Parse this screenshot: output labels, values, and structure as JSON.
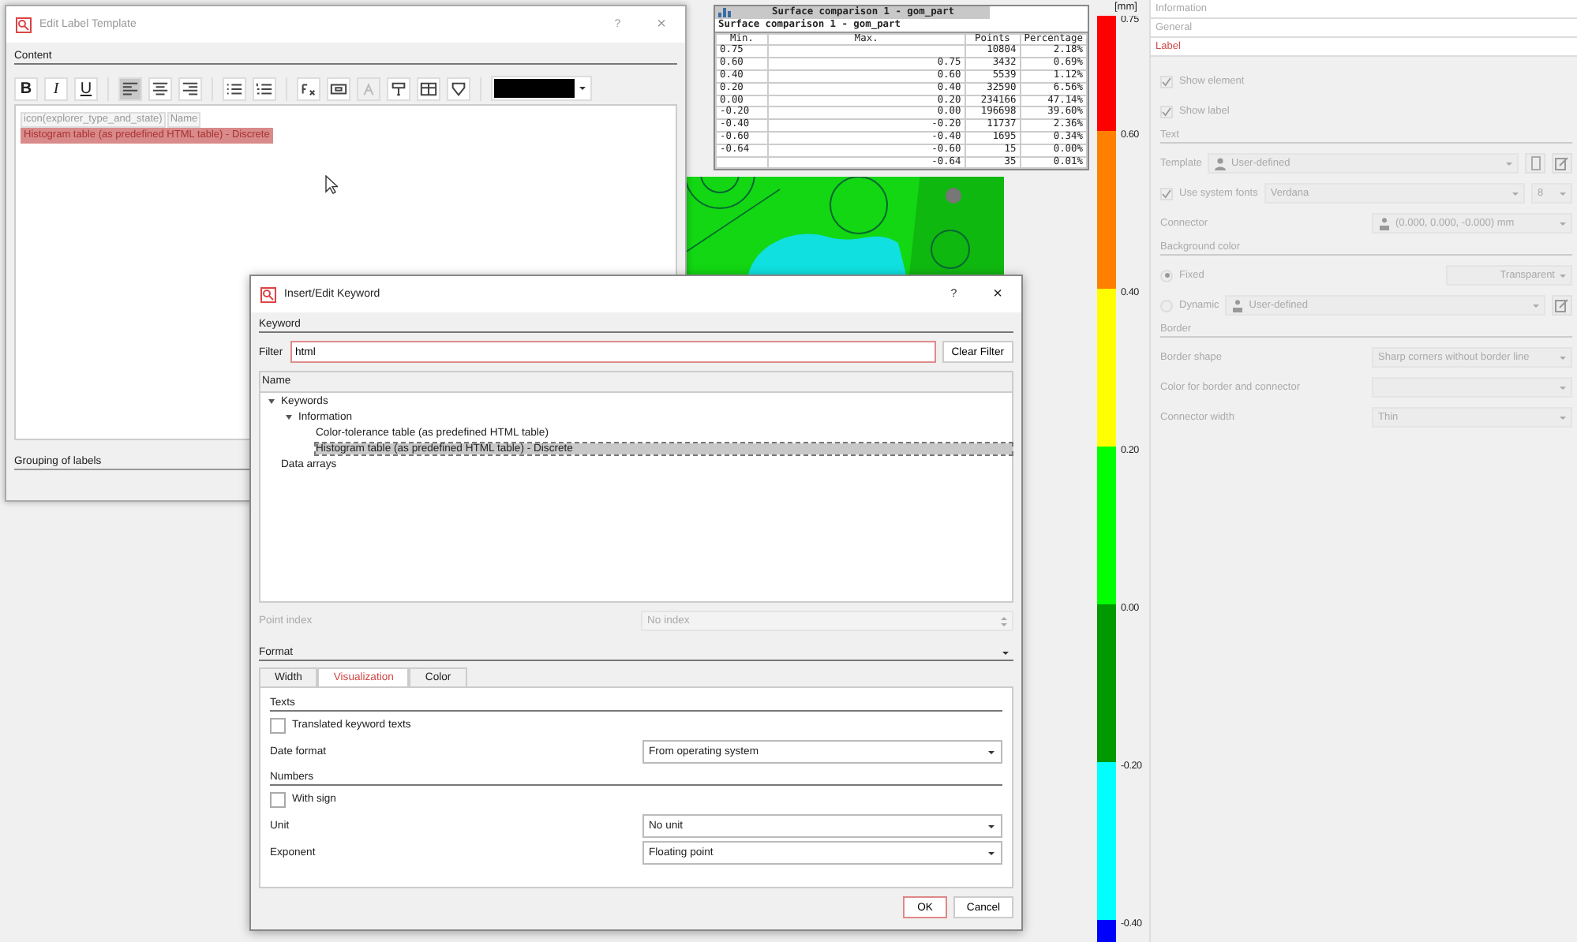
{
  "label_template_window": {
    "title": "Edit Label Template",
    "help": "?",
    "close": "×",
    "content_heading": "Content",
    "toolbar_groups": [
      {
        "tools": [
          {
            "kind": "bold",
            "label": "B",
            "pressed": false,
            "disabled": false
          },
          {
            "kind": "italic",
            "label": "I",
            "pressed": false,
            "disabled": false
          },
          {
            "kind": "underline",
            "label": "U",
            "pressed": false,
            "disabled": false
          }
        ]
      },
      {
        "tools": [
          {
            "kind": "align-left",
            "pressed": true,
            "disabled": false
          },
          {
            "kind": "align-center",
            "pressed": false,
            "disabled": false
          },
          {
            "kind": "align-right",
            "pressed": false,
            "disabled": false
          }
        ]
      },
      {
        "tools": [
          {
            "kind": "bullet-list",
            "pressed": false,
            "disabled": false
          },
          {
            "kind": "number-list",
            "pressed": false,
            "disabled": false
          }
        ]
      },
      {
        "tools": [
          {
            "kind": "formula",
            "pressed": false,
            "disabled": false
          },
          {
            "kind": "image",
            "pressed": false,
            "disabled": false
          },
          {
            "kind": "symbol",
            "pressed": false,
            "disabled": true
          },
          {
            "kind": "format-paint",
            "pressed": false,
            "disabled": false
          },
          {
            "kind": "table",
            "pressed": false,
            "disabled": false
          },
          {
            "kind": "insert-field",
            "pressed": false,
            "disabled": false
          }
        ]
      }
    ],
    "editor_lines": [
      {
        "tokens": [
          {
            "text": "icon(explorer_type_and_state)",
            "selected": false
          },
          {
            "text": "Name",
            "selected": false
          }
        ]
      },
      {
        "tokens": [
          {
            "text": "Histogram table (as predefined HTML table) - Discrete",
            "selected": true
          }
        ]
      }
    ],
    "grouping_heading": "Grouping of labels"
  },
  "histogram_table": {
    "title": "Surface comparison 1 - gom_part",
    "subtitle": "Surface comparison 1 - gom_part",
    "columns": [
      "Min.",
      "Max.",
      "Points",
      "Percentage"
    ],
    "rows": [
      {
        "min": "0.75",
        "points": "10804",
        "percentage": "2.18%"
      },
      {
        "min": "0.60",
        "max": "0.75",
        "points": "3432",
        "percentage": "0.69%"
      },
      {
        "min": "0.40",
        "max": "0.60",
        "points": "5539",
        "percentage": "1.12%"
      },
      {
        "min": "0.20",
        "max": "0.40",
        "points": "32590",
        "percentage": "6.56%"
      },
      {
        "min": "0.00",
        "max": "0.20",
        "points": "234166",
        "percentage": "47.14%"
      },
      {
        "min": "-0.20",
        "max": "0.00",
        "points": "196698",
        "percentage": "39.60%"
      },
      {
        "min": "-0.40",
        "max": "-0.20",
        "points": "11737",
        "percentage": "2.36%"
      },
      {
        "min": "-0.60",
        "max": "-0.40",
        "points": "1695",
        "percentage": "0.34%"
      },
      {
        "min": "-0.64",
        "max": "-0.60",
        "points": "15",
        "percentage": "0.00%"
      },
      {
        "max": "-0.64",
        "points": "35",
        "percentage": "0.01%"
      }
    ]
  },
  "color_scale": {
    "unit": "[mm]",
    "segments": [
      {
        "label": "0.75",
        "color": "#ff0000"
      },
      {
        "label": "0.60",
        "color": "#ff8000"
      },
      {
        "label": "0.40",
        "color": "#ffff00"
      },
      {
        "label": "0.20",
        "color": "#00ff00"
      },
      {
        "label": "0.00",
        "color": "#009900"
      },
      {
        "label": "-0.20",
        "color": "#00ffff"
      },
      {
        "label": "-0.40",
        "color": "#0000ff"
      }
    ]
  },
  "side_panel": {
    "nav": [
      {
        "label": "Information",
        "selected": false
      },
      {
        "label": "General",
        "selected": false
      },
      {
        "label": "Label",
        "selected": true
      }
    ],
    "properties": [
      {
        "kind": "check",
        "label": "Show element",
        "checked": true
      },
      {
        "kind": "check",
        "label": "Show label",
        "checked": true
      },
      {
        "kind": "section",
        "label": "Text"
      },
      {
        "kind": "template",
        "label": "Template",
        "value": "User-defined"
      },
      {
        "kind": "font",
        "label": "Use system fonts",
        "checked": true,
        "value": "Verdana",
        "size": "8"
      },
      {
        "kind": "connector",
        "label": "Connector",
        "value": "(0.000, 0.000, -0.000) mm"
      },
      {
        "kind": "section",
        "label": "Background color"
      },
      {
        "kind": "radio",
        "label": "Fixed",
        "selected": true,
        "value": "Transparent"
      },
      {
        "kind": "radio-combo",
        "label": "Dynamic",
        "selected": false,
        "value": "User-defined"
      },
      {
        "kind": "section",
        "label": "Border"
      },
      {
        "kind": "combo",
        "label": "Border shape",
        "value": "Sharp corners without border line"
      },
      {
        "kind": "combo",
        "label": "Color for border and connector"
      },
      {
        "kind": "combo",
        "label": "Connector width",
        "value": "Thin"
      }
    ]
  },
  "keyword_dialog": {
    "title": "Insert/Edit Keyword",
    "help": "?",
    "close": "×",
    "keyword_heading": "Keyword",
    "filter_label": "Filter",
    "filter_value": "html",
    "clear_button": "Clear Filter",
    "tree_header": "Name",
    "tree": [
      {
        "label": "Keywords",
        "expanded": true,
        "selected": false,
        "children": [
          {
            "label": "Information",
            "expanded": true,
            "selected": false,
            "children": [
              {
                "label": "Color-tolerance table (as predefined HTML table)",
                "selected": false
              },
              {
                "label": "Histogram table (as predefined HTML table) - Discrete",
                "selected": true
              }
            ]
          }
        ]
      },
      {
        "label": "Data arrays",
        "selected": false
      }
    ],
    "point_index_label": "Point index",
    "point_index_value": "No index",
    "format_heading": "Format",
    "tabs": [
      {
        "label": "Width",
        "selected": false
      },
      {
        "label": "Visualization",
        "selected": true
      },
      {
        "label": "Color",
        "selected": false
      }
    ],
    "form": [
      {
        "kind": "section",
        "label": "Texts"
      },
      {
        "kind": "check",
        "label": "Translated keyword texts",
        "checked": false
      },
      {
        "kind": "combo",
        "label": "Date format",
        "value": "From operating system"
      },
      {
        "kind": "section",
        "label": "Numbers"
      },
      {
        "kind": "check",
        "label": "With sign",
        "checked": false
      },
      {
        "kind": "combo",
        "label": "Unit",
        "value": "No unit"
      },
      {
        "kind": "combo",
        "label": "Exponent",
        "value": "Floating point"
      }
    ],
    "ok": "OK",
    "cancel": "Cancel"
  }
}
